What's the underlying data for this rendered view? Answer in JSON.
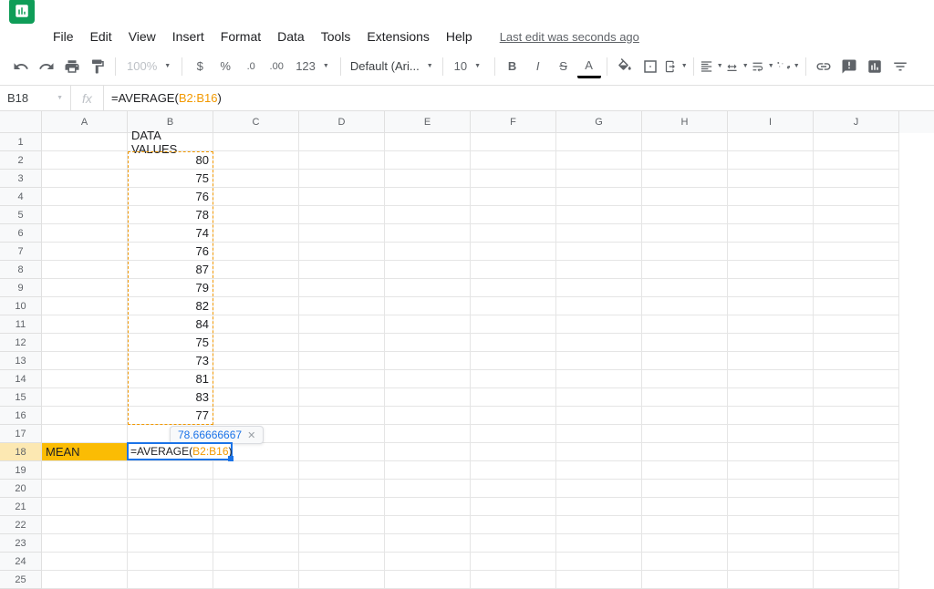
{
  "header": {
    "title": ""
  },
  "menu": {
    "items": [
      "File",
      "Edit",
      "View",
      "Insert",
      "Format",
      "Data",
      "Tools",
      "Extensions",
      "Help"
    ],
    "last_edit": "Last edit was seconds ago"
  },
  "toolbar": {
    "zoom": "100%",
    "font": "Default (Ari...",
    "font_size": "10",
    "more_formats": "123"
  },
  "name_box": "B18",
  "formula_bar": {
    "prefix": "=AVERAGE(",
    "range": "B2:B16",
    "suffix": ")"
  },
  "columns": [
    "A",
    "B",
    "C",
    "D",
    "E",
    "F",
    "G",
    "H",
    "I",
    "J"
  ],
  "row_count": 25,
  "sheet": {
    "b1": "DATA VALUES",
    "data": [
      "80",
      "75",
      "76",
      "78",
      "74",
      "76",
      "87",
      "79",
      "82",
      "84",
      "75",
      "73",
      "81",
      "83",
      "77"
    ],
    "a18": "MEAN"
  },
  "tooltip": {
    "value": "78.66666667"
  },
  "active_formula": {
    "prefix": "=AVERAGE(",
    "range": "B2:B16",
    "suffix": ")"
  },
  "selection": {
    "top_row": 2,
    "bottom_row": 16,
    "col": "B"
  },
  "active": {
    "row": 18,
    "col": "B"
  }
}
